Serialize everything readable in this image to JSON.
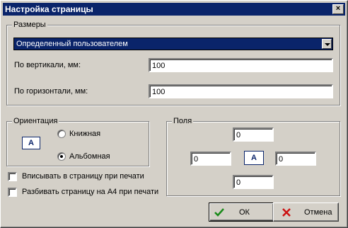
{
  "window": {
    "title": "Настройка страницы",
    "close": "×"
  },
  "size_group": {
    "label": "Размеры",
    "select_value": "Определенный пользователем",
    "vertical_label": "По вертикали, мм:",
    "vertical_value": "100",
    "horizontal_label": "По горизонтали, мм:",
    "horizontal_value": "100"
  },
  "orientation_group": {
    "label": "Ориентация",
    "preview_letter": "A",
    "portrait_label": "Книжная",
    "landscape_label": "Альбомная",
    "selected": "landscape"
  },
  "margins_group": {
    "label": "Поля",
    "top": "0",
    "left": "0",
    "right": "0",
    "bottom": "0",
    "preview_letter": "A"
  },
  "options": {
    "fit_to_page": "Вписывать в страницу при печати",
    "split_a4": "Разбивать страницу на А4 при печати"
  },
  "buttons": {
    "ok": "ОК",
    "cancel": "Отмена"
  },
  "colors": {
    "titlebar": "#0a246a",
    "ok_icon": "#1a8a1a",
    "cancel_icon": "#cc1111"
  }
}
